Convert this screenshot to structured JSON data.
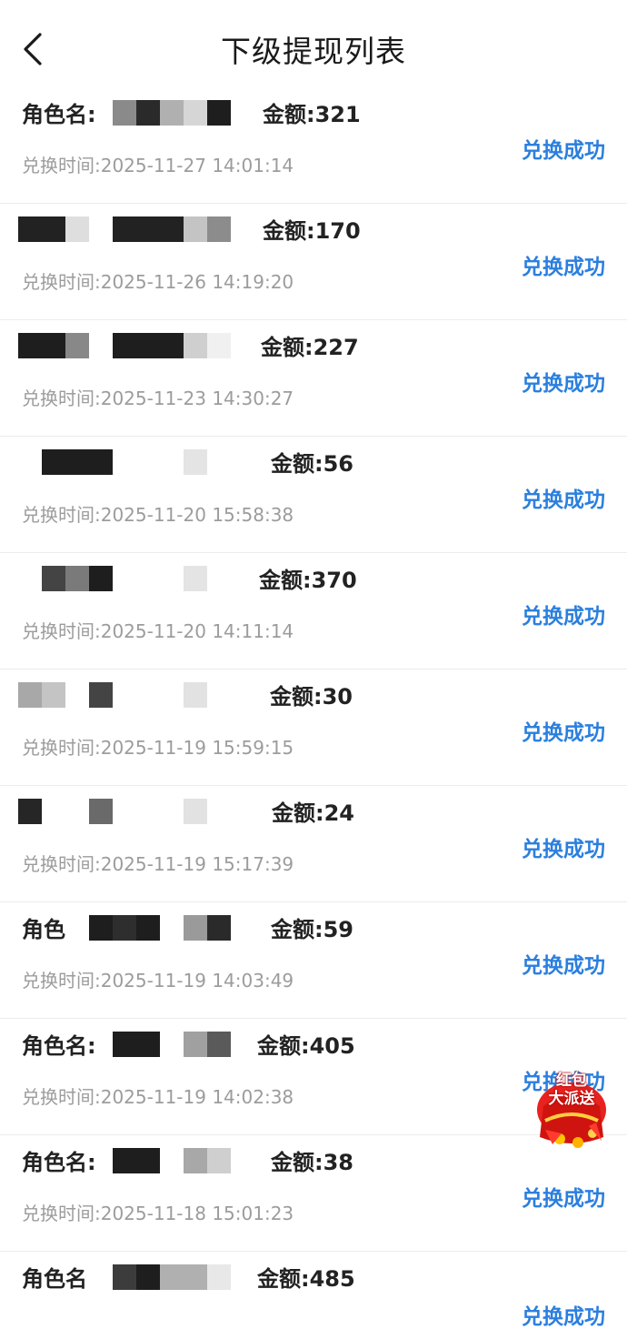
{
  "header": {
    "title": "下级提现列表",
    "back_icon": "chevron-left-icon"
  },
  "colors": {
    "status": "#2b7fde",
    "time": "#9c9c9c",
    "text": "#222222"
  },
  "records": [
    {
      "role": "角色名:",
      "amount": "金额:321",
      "time": "兑换时间:2025-11-27 14:01:14",
      "status": "兑换成功"
    },
    {
      "role": "",
      "amount": "金额:170",
      "time": "兑换时间:2025-11-26 14:19:20",
      "status": "兑换成功"
    },
    {
      "role": "",
      "amount": "金额:227",
      "time": "兑换时间:2025-11-23 14:30:27",
      "status": "兑换成功"
    },
    {
      "role": "",
      "amount": "金额:56",
      "time": "兑换时间:2025-11-20 15:58:38",
      "status": "兑换成功"
    },
    {
      "role": "",
      "amount": "金额:370",
      "time": "兑换时间:2025-11-20 14:11:14",
      "status": "兑换成功"
    },
    {
      "role": "",
      "amount": "金额:30",
      "time": "兑换时间:2025-11-19 15:59:15",
      "status": "兑换成功"
    },
    {
      "role": "",
      "amount": "金额:24",
      "time": "兑换时间:2025-11-19 15:17:39",
      "status": "兑换成功"
    },
    {
      "role": "角色",
      "amount": "金额:59",
      "time": "兑换时间:2025-11-19 14:03:49",
      "status": "兑换成功"
    },
    {
      "role": "角色名:",
      "amount": "金额:405",
      "time": "兑换时间:2025-11-19 14:02:38",
      "status": "兑换成功"
    },
    {
      "role": "角色名:",
      "amount": "金额:38",
      "time": "兑换时间:2025-11-18 15:01:23",
      "status": "兑换成功"
    },
    {
      "role": "角色名",
      "amount": "金额:485",
      "time": "",
      "status": "兑换成功"
    }
  ],
  "floating_badge": {
    "line1": "红包",
    "line2": "大派送",
    "icon": "red-packet-icon"
  }
}
